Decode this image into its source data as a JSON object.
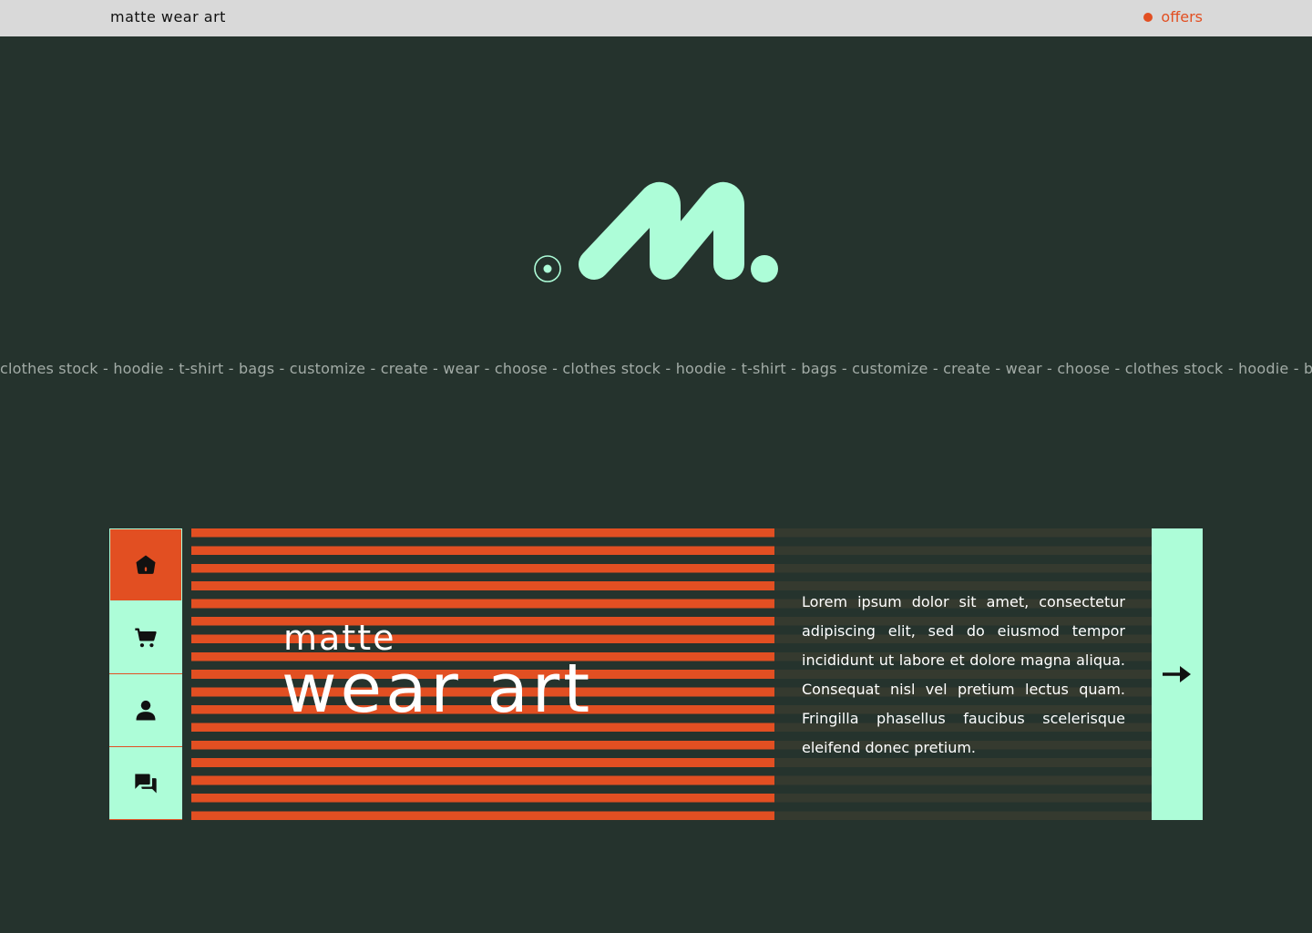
{
  "header": {
    "brand": "matte wear art",
    "offers_label": "offers"
  },
  "marquee": {
    "text": "clothes stock - hoodie - t-shirt - bags - customize  - create - wear - choose - clothes stock - hoodie - t-shirt - bags - customize - create - wear - choose - clothes stock - hoodie - bags"
  },
  "sidebar": {
    "items": [
      {
        "icon": "home-icon",
        "active": true
      },
      {
        "icon": "cart-icon",
        "active": false
      },
      {
        "icon": "user-icon",
        "active": false
      },
      {
        "icon": "chat-icon",
        "active": false
      }
    ]
  },
  "hero": {
    "title_small": "matte",
    "title_big": "wear art",
    "description": "Lorem ipsum dolor sit amet, consectetur adipiscing elit, sed do eiusmod tempor incididunt ut labore et dolore magna aliqua. Consequat nisl vel pretium lectus quam. Fringilla phasellus faucibus scelerisque eleifend donec pretium.",
    "next_icon": "arrow-right-icon"
  },
  "colors": {
    "background": "#25332d",
    "accent_orange": "#e24f22",
    "accent_mint": "#adfdd8",
    "topbar": "#d9d9d9"
  }
}
